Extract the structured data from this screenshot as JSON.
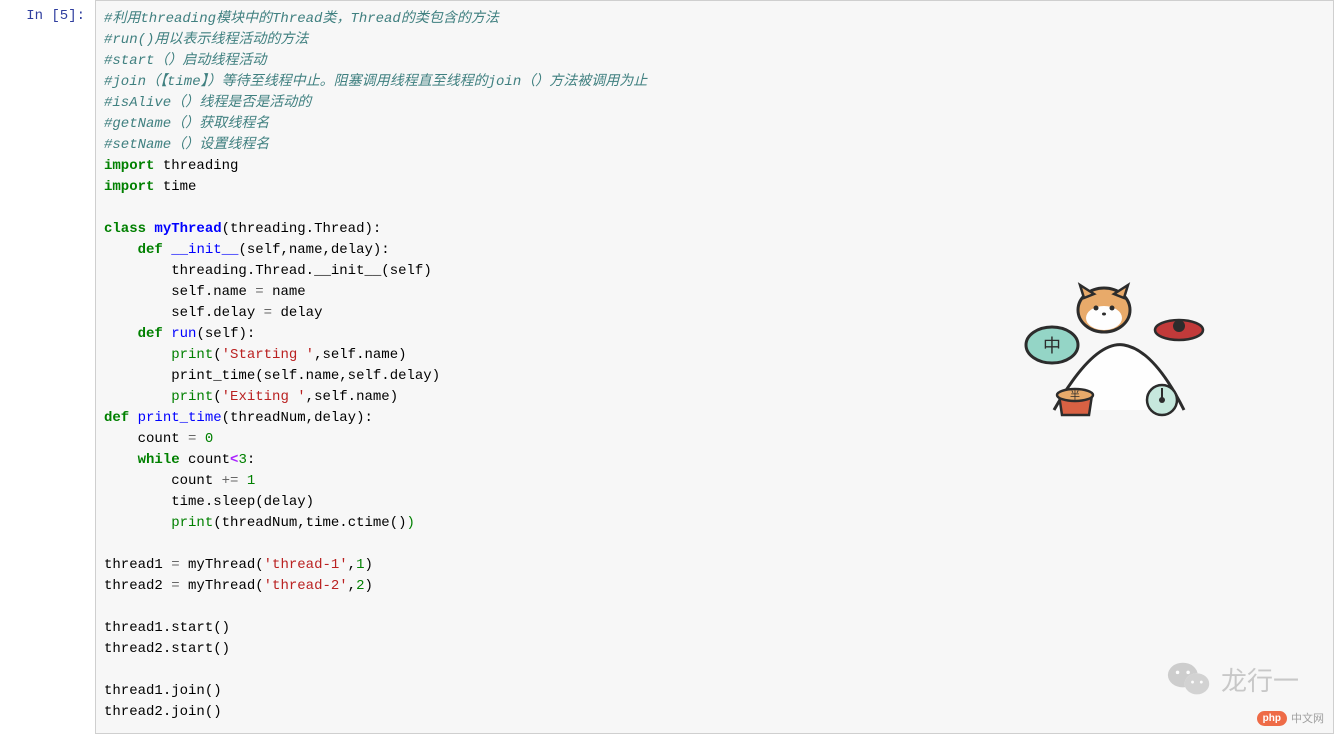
{
  "prompt": {
    "label": "In [5]:"
  },
  "code": {
    "comments": {
      "c1": "#利用threading模块中的Thread类，Thread的类包含的方法",
      "c2": "#run()用以表示线程活动的方法",
      "c3": "#start（）启动线程活动",
      "c4": "#join（【time】）等待至线程中止。阻塞调用线程直至线程的join（）方法被调用为止",
      "c5": "#isAlive（）线程是否是活动的",
      "c6": "#getName（）获取线程名",
      "c7": "#setName（）设置线程名"
    },
    "keywords": {
      "import": "import",
      "class": "class",
      "def": "def",
      "while": "while"
    },
    "modules": {
      "threading": "threading",
      "time": "time"
    },
    "classes": {
      "myThread": "myThread",
      "Thread": "Thread"
    },
    "functions": {
      "init": "__init__",
      "run": "run",
      "print_time": "print_time",
      "print": "print",
      "sleep": "sleep",
      "ctime": "ctime",
      "start": "start",
      "join": "join"
    },
    "params": {
      "self": "self",
      "name": "name",
      "delay": "delay",
      "threadNum": "threadNum",
      "count": "count"
    },
    "strings": {
      "starting": "'Starting '",
      "exiting": "'Exiting '",
      "thread1": "'thread-1'",
      "thread2": "'thread-2'"
    },
    "numbers": {
      "zero": "0",
      "one": "1",
      "two": "2",
      "three": "3"
    },
    "operators": {
      "eq": "=",
      "lt": "<",
      "pluseq": "+="
    },
    "vars": {
      "thread1": "thread1",
      "thread2": "thread2"
    }
  },
  "watermarks": {
    "wechat_text": "龙行一",
    "php_badge": "php",
    "php_text": "中文网"
  }
}
